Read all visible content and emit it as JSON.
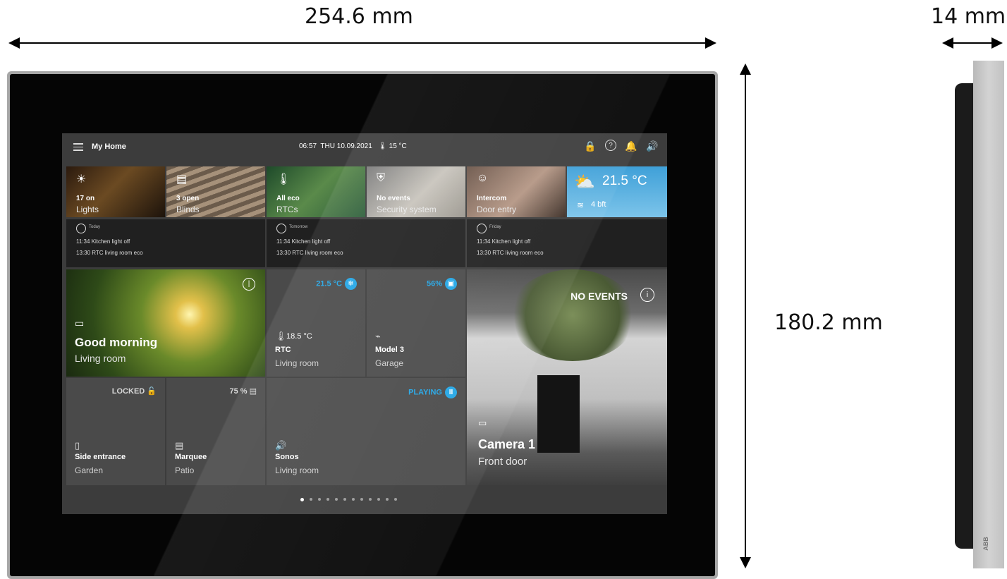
{
  "dimensions": {
    "width": "254.6 mm",
    "depth": "14 mm",
    "height": "180.2 mm"
  },
  "topbar": {
    "title": "My Home",
    "time": "06:57",
    "date": "THU 10.09.2021",
    "outside_temp": "15 °C",
    "icons": [
      "menu-icon",
      "lock-icon",
      "help-icon",
      "bell-icon",
      "volume-icon"
    ]
  },
  "tiles": [
    {
      "value": "17 on",
      "label": "Lights",
      "icon": "bulb-icon"
    },
    {
      "value": "3 open",
      "label": "Blinds",
      "icon": "blind-icon"
    },
    {
      "value": "All eco",
      "label": "RTCs",
      "icon": "thermometer-icon"
    },
    {
      "value": "No events",
      "label": "Security system",
      "icon": "shield-icon"
    },
    {
      "value": "Intercom",
      "label": "Door entry",
      "icon": "person-icon"
    }
  ],
  "weather": {
    "temp": "21.5 °C",
    "wind": "4 bft",
    "icon": "partly-cloudy-icon"
  },
  "schedule": [
    {
      "day": "Today",
      "line1": "11:34 Kitchen light off",
      "line2": "13:30 RTC living room eco"
    },
    {
      "day": "Tomorrow",
      "line1": "11:34 Kitchen light off",
      "line2": "13:30 RTC living room eco"
    },
    {
      "day": "Friday",
      "line1": "11:34 Kitchen light off",
      "line2": "13:30 RTC living room eco"
    }
  ],
  "scene": {
    "title": "Good morning",
    "room": "Living room"
  },
  "rtc": {
    "setpoint": "21.5 °C",
    "current": "18.5 °C",
    "name": "RTC",
    "room": "Living room"
  },
  "car": {
    "charge": "56%",
    "name": "Model 3",
    "room": "Garage"
  },
  "camera": {
    "status": "NO EVENTS",
    "name": "Camera 1",
    "room": "Front door"
  },
  "lock": {
    "status": "LOCKED",
    "name": "Side entrance",
    "room": "Garden"
  },
  "marquee": {
    "status": "75 %",
    "name": "Marquee",
    "room": "Patio"
  },
  "sonos": {
    "status": "PLAYING",
    "name": "Sonos",
    "room": "Living room"
  },
  "pager": {
    "count": 12,
    "active": 0
  },
  "brand": "ABB",
  "colors": {
    "accent": "#22a6e6",
    "tile": "#4a4a4a",
    "screen": "#3c3c3c"
  }
}
